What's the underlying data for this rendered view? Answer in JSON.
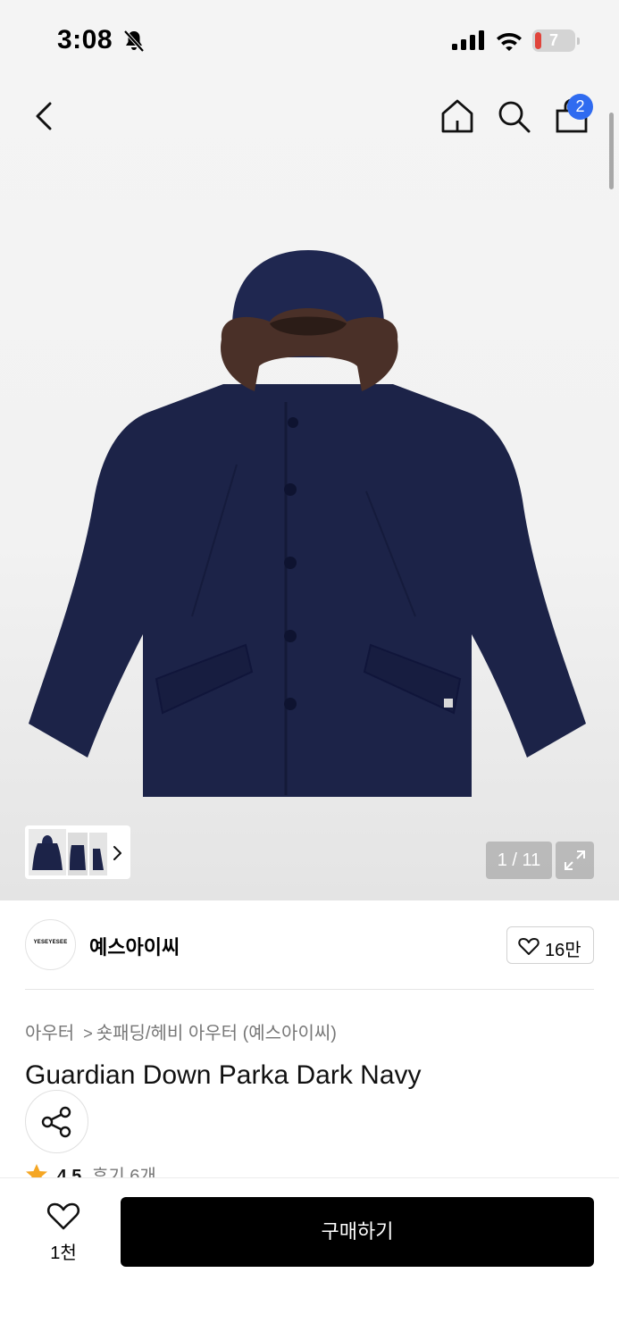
{
  "status_bar": {
    "time": "3:08",
    "battery": "7"
  },
  "header": {
    "cart_count": "2"
  },
  "gallery": {
    "counter": "1 / 11"
  },
  "brand": {
    "name": "예스아이씨",
    "logo_text": "YESEYESEE",
    "likes": "16만"
  },
  "breadcrumb": {
    "category": "아우터",
    "subcategory": "숏패딩/헤비 아우터 (예스아이씨)"
  },
  "product": {
    "title": "Guardian Down Parka Dark Navy"
  },
  "rating": {
    "score": "4.5",
    "reviews": "후기 6개"
  },
  "bottom": {
    "wish_count": "1천",
    "buy_label": "구매하기"
  },
  "colors": {
    "badge": "#2f6bf0",
    "star": "#f5a623",
    "buy_button": "#000000",
    "jacket": "#1c2348",
    "fur": "#4a3028"
  }
}
